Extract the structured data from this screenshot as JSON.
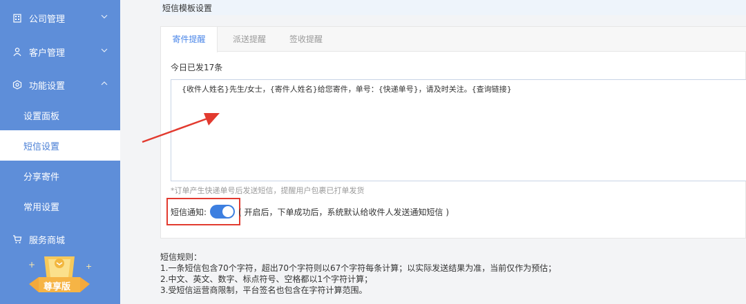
{
  "sidebar": {
    "items": [
      {
        "label": "公司管理",
        "icon": "building-icon"
      },
      {
        "label": "客户管理",
        "icon": "user-icon"
      },
      {
        "label": "功能设置",
        "icon": "settings-icon"
      },
      {
        "label": "服务商城",
        "icon": "cart-icon"
      }
    ],
    "subitems": [
      {
        "label": "设置面板"
      },
      {
        "label": "短信设置"
      },
      {
        "label": "分享寄件"
      },
      {
        "label": "常用设置"
      }
    ],
    "badge": "尊享版"
  },
  "panel": {
    "title": "短信模板设置",
    "tabs": [
      "寄件提醒",
      "派送提醒",
      "签收提醒"
    ],
    "today_count": "今日已发17条",
    "template_text": "{收件人姓名}先生/女士，{寄件人姓名}给您寄件，单号：{快递单号}，请及时关注。{查询链接}",
    "hint": "*订单产生快递单号后发送短信，提醒用户包裹已打单发货",
    "notify_label": "短信通知:",
    "notify_on": true,
    "notify_desc": "( 开启后，下单成功后，系统默认给收件人发送通知短信 )"
  },
  "rules": {
    "title": "短信规则：",
    "lines": [
      "1.一条短信包含70个字符，超出70个字符则以67个字符每条计算；以实际发送结果为准，当前仅作为预估；",
      "2.中文、英文、数字、标点符号、空格都以1个字符计算；",
      "3.受短信运营商限制，平台签名也包含在字符计算范围。"
    ]
  },
  "colors": {
    "sidebar_bg": "#5e8ed9",
    "accent": "#4a86e8",
    "highlight_box": "#e23a2f",
    "arrow": "#e23a2f",
    "toggle_on": "#3d7fe0"
  }
}
